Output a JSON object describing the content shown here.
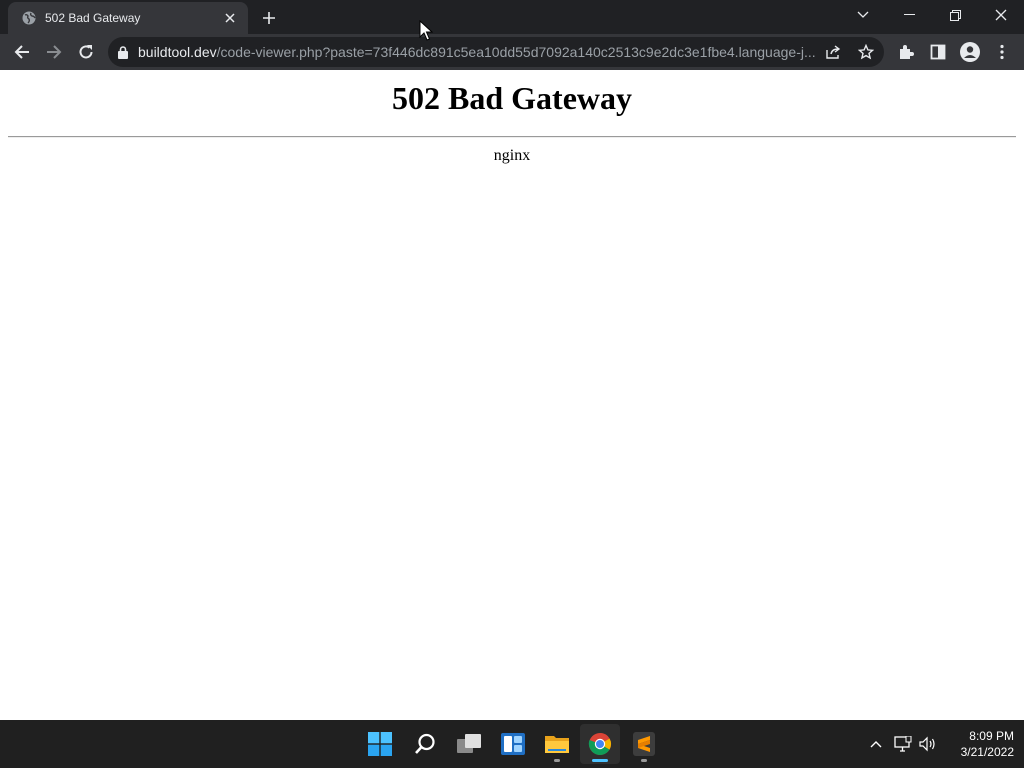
{
  "browser": {
    "tab": {
      "title": "502 Bad Gateway",
      "favicon": "globe-icon"
    },
    "url": {
      "host": "buildtool.dev",
      "path": "/code-viewer.php?paste=73f446dc891c5ea10dd55d7092a140c2513c9e2dc3e1fbe4.language-j..."
    },
    "colors": {
      "tabstrip": "#202124",
      "toolbar": "#35363a",
      "omnibox": "#202124"
    }
  },
  "page": {
    "heading": "502 Bad Gateway",
    "server": "nginx"
  },
  "taskbar": {
    "apps": [
      {
        "name": "start",
        "icon": "windows-start-icon"
      },
      {
        "name": "search",
        "icon": "search-icon"
      },
      {
        "name": "task-view",
        "icon": "task-view-icon"
      },
      {
        "name": "widgets",
        "icon": "widgets-icon"
      },
      {
        "name": "file-explorer",
        "icon": "folder-icon"
      },
      {
        "name": "chrome",
        "icon": "chrome-icon"
      },
      {
        "name": "sublime-text",
        "icon": "sublime-text-icon"
      }
    ],
    "clock": {
      "time": "8:09 PM",
      "date": "3/21/2022"
    }
  }
}
